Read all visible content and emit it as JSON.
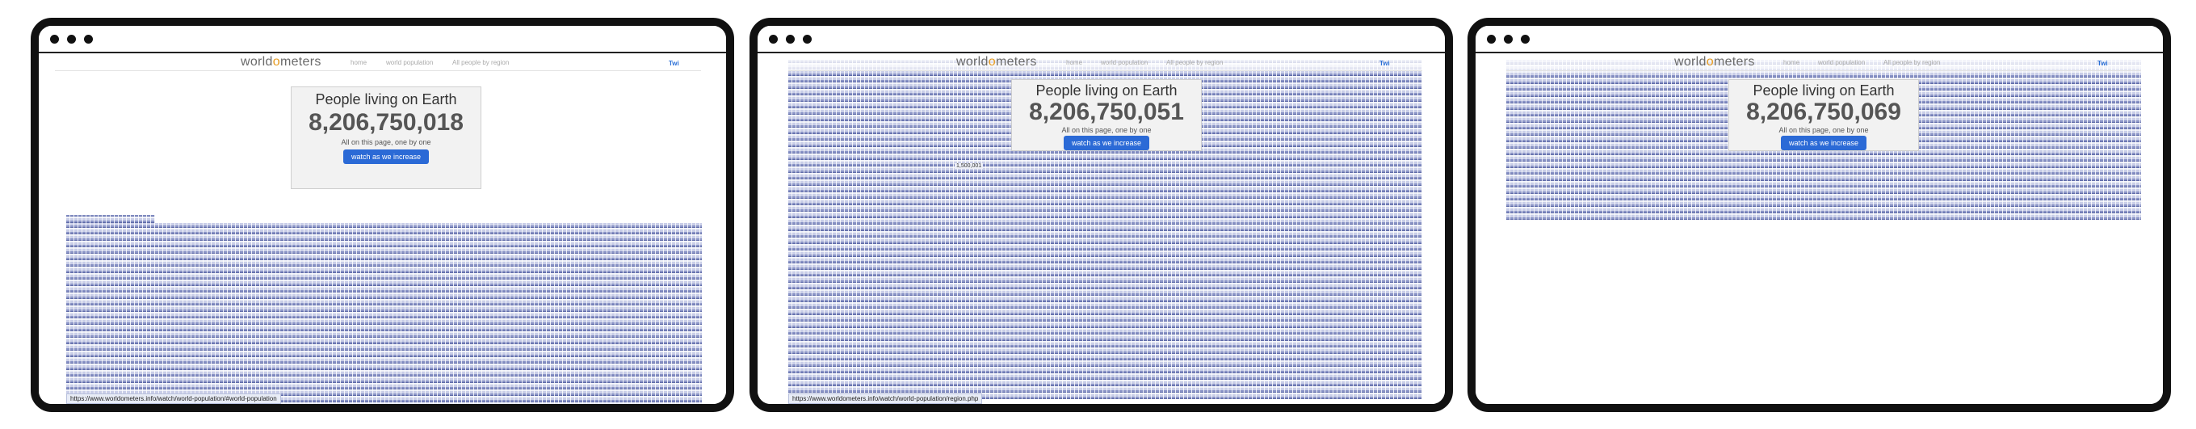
{
  "site": {
    "logo_prefix": "world",
    "logo_o": "o",
    "logo_suffix": "meters",
    "nav": [
      "home",
      "world population",
      "All people by region"
    ],
    "twitter_label": "Twi"
  },
  "counter": {
    "title": "People living on Earth",
    "subtitle": "All on this page, one by one",
    "button_label": "watch as we increase"
  },
  "windows": [
    {
      "population": "8,206,750,018",
      "status_url": "https://www.worldometers.info/watch/world-population/#world-population"
    },
    {
      "population": "8,206,750,051",
      "status_url": "https://www.worldometers.info/watch/world-population/region.php",
      "row_label": "1,500,001"
    },
    {
      "population": "8,206,750,069"
    }
  ]
}
